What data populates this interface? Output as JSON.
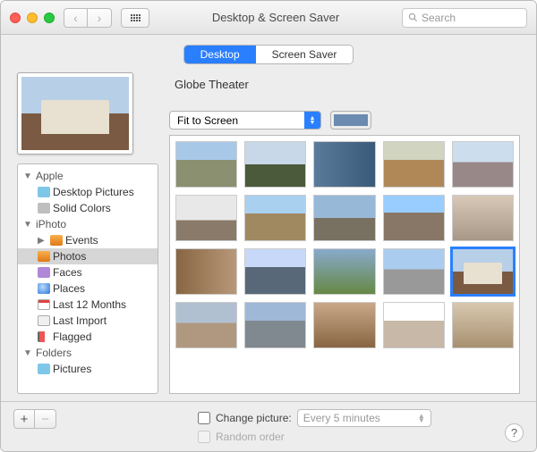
{
  "window": {
    "title": "Desktop & Screen Saver"
  },
  "search": {
    "placeholder": "Search"
  },
  "tabs": {
    "desktop": "Desktop",
    "screensaver": "Screen Saver",
    "active": "desktop"
  },
  "current_image": {
    "name": "Globe Theater"
  },
  "fit_mode": {
    "selected": "Fit to Screen"
  },
  "color_swatch": "#6b8bb0",
  "sidebar": {
    "groups": [
      {
        "label": "Apple",
        "expanded": true,
        "items": [
          {
            "label": "Desktop Pictures",
            "icon": "folder"
          },
          {
            "label": "Solid Colors",
            "icon": "gray"
          }
        ]
      },
      {
        "label": "iPhoto",
        "expanded": true,
        "items": [
          {
            "label": "Events",
            "icon": "orange",
            "hasChildren": true
          },
          {
            "label": "Photos",
            "icon": "orange",
            "selected": true
          },
          {
            "label": "Faces",
            "icon": "purple"
          },
          {
            "label": "Places",
            "icon": "globe"
          },
          {
            "label": "Last 12 Months",
            "icon": "cal"
          },
          {
            "label": "Last Import",
            "icon": "arrow"
          },
          {
            "label": "Flagged",
            "icon": "flag"
          }
        ]
      },
      {
        "label": "Folders",
        "expanded": true,
        "items": [
          {
            "label": "Pictures",
            "icon": "folder"
          }
        ]
      }
    ]
  },
  "footer": {
    "change_label": "Change picture:",
    "interval": "Every 5 minutes",
    "random_label": "Random order",
    "change_checked": false,
    "random_checked": false
  }
}
